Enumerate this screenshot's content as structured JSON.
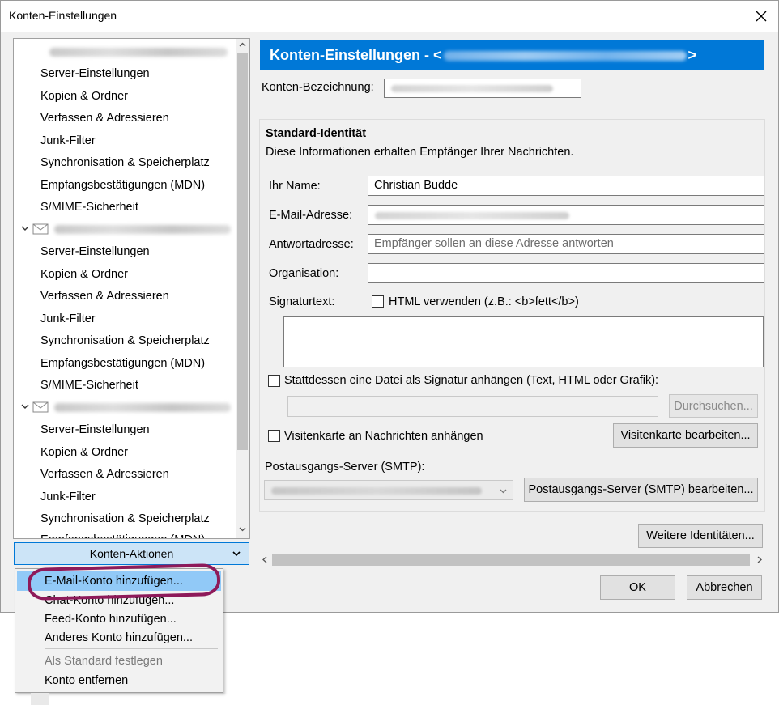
{
  "window": {
    "title": "Konten-Einstellungen"
  },
  "tree": {
    "accounts": [
      {
        "items": [
          "Server-Einstellungen",
          "Kopien & Ordner",
          "Verfassen & Adressieren",
          "Junk-Filter",
          "Synchronisation & Speicherplatz",
          "Empfangsbestätigungen (MDN)",
          "S/MIME-Sicherheit"
        ]
      },
      {
        "items": [
          "Server-Einstellungen",
          "Kopien & Ordner",
          "Verfassen & Adressieren",
          "Junk-Filter",
          "Synchronisation & Speicherplatz",
          "Empfangsbestätigungen (MDN)",
          "S/MIME-Sicherheit"
        ]
      },
      {
        "items": [
          "Server-Einstellungen",
          "Kopien & Ordner",
          "Verfassen & Adressieren",
          "Junk-Filter",
          "Synchronisation & Speicherplatz",
          "Empfangsbestätigungen (MDN)"
        ]
      }
    ]
  },
  "actions": {
    "label": "Konten-Aktionen",
    "menu": {
      "items": [
        {
          "label": "E-Mail-Konto hinzufügen...",
          "state": "highlighted"
        },
        {
          "label": "Chat-Konto hinzufügen...",
          "state": "normal"
        },
        {
          "label": "Feed-Konto hinzufügen...",
          "state": "normal"
        },
        {
          "label": "Anderes Konto hinzufügen...",
          "state": "normal"
        },
        {
          "label": "Als Standard festlegen",
          "state": "disabled"
        },
        {
          "label": "Konto entfernen",
          "state": "normal"
        }
      ]
    }
  },
  "panel": {
    "header_prefix": "Konten-Einstellungen - <",
    "header_suffix": ">",
    "konten_bezeichnung_label": "Konten-Bezeichnung:",
    "identity": {
      "title": "Standard-Identität",
      "description": "Diese Informationen erhalten Empfänger Ihrer Nachrichten.",
      "name_label": "Ihr Name:",
      "name_value": "Christian Budde",
      "email_label": "E-Mail-Adresse:",
      "reply_label": "Antwortadresse:",
      "reply_placeholder": "Empfänger sollen an diese Adresse antworten",
      "org_label": "Organisation:",
      "sig_label": "Signaturtext:",
      "html_checkbox": "HTML verwenden (z.B.: <b>fett</b>)",
      "sigfile_checkbox": "Stattdessen eine Datei als Signatur anhängen (Text, HTML oder Grafik):",
      "browse_button": "Durchsuchen...",
      "vcard_checkbox": "Visitenkarte an Nachrichten anhängen",
      "vcard_button": "Visitenkarte bearbeiten...",
      "smtp_label": "Postausgangs-Server (SMTP):",
      "smtp_button": "Postausgangs-Server (SMTP) bearbeiten..."
    },
    "more_identities_button": "Weitere Identitäten...",
    "ok_button": "OK",
    "cancel_button": "Abbrechen"
  },
  "colors": {
    "accent": "#0078d7",
    "annotation": "#8e1a5a",
    "menu_highlight": "#91c9f7"
  }
}
